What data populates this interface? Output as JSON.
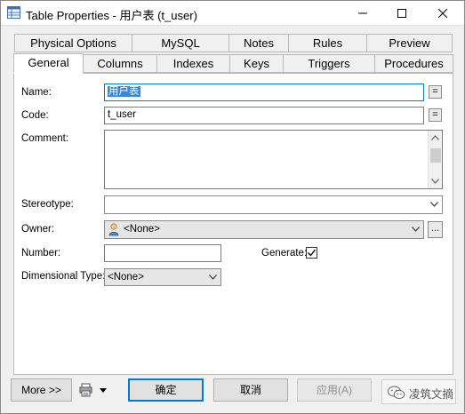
{
  "window": {
    "title": "Table Properties - 用户表 (t_user)"
  },
  "tabs": {
    "row_top": [
      "Physical Options",
      "MySQL",
      "Notes",
      "Rules",
      "Preview"
    ],
    "row_bottom": [
      "General",
      "Columns",
      "Indexes",
      "Keys",
      "Triggers",
      "Procedures"
    ],
    "active": "General"
  },
  "form": {
    "name_label": "Name:",
    "name_value": "用户表",
    "code_label": "Code:",
    "code_value": "t_user",
    "comment_label": "Comment:",
    "comment_value": "",
    "stereotype_label": "Stereotype:",
    "stereotype_value": "",
    "owner_label": "Owner:",
    "owner_value": "<None>",
    "number_label": "Number:",
    "number_value": "",
    "generate_label": "Generate:",
    "generate_checked": true,
    "dimensional_type_label": "Dimensional Type:",
    "dimensional_type_value": "<None>",
    "equals_glyph": "=",
    "ellipsis_glyph": "..."
  },
  "buttons": {
    "more": "More >>",
    "ok": "确定",
    "cancel": "取消",
    "apply": "应用(A)"
  },
  "watermark": {
    "text": "凌筑文摘"
  },
  "icons": {
    "app": "table-properties-icon",
    "owner": "user-icon",
    "print": "print-icon",
    "watermark": "wechat-icon"
  }
}
